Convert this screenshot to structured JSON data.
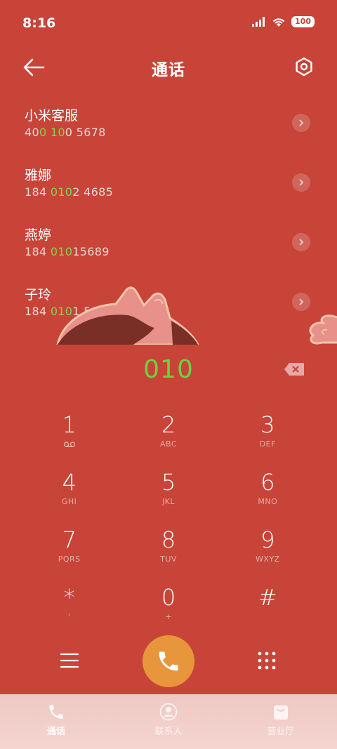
{
  "status": {
    "time": "8:16",
    "battery": "100"
  },
  "header": {
    "title": "通话"
  },
  "results": [
    {
      "name": "小米客服",
      "num_pre": "40",
      "num_match": "0 10",
      "num_post": "0 5678"
    },
    {
      "name": "雅娜",
      "num_pre": "184 ",
      "num_match": "010",
      "num_post": "2 4685"
    },
    {
      "name": "燕婷",
      "num_pre": "184 ",
      "num_match": "010",
      "num_post": "15689"
    },
    {
      "name": "子玲",
      "num_pre": "184 ",
      "num_match": "010",
      "num_post": "1 5678"
    }
  ],
  "dialer": {
    "input": "010"
  },
  "keys": [
    {
      "digit": "1",
      "letters": "voicemail"
    },
    {
      "digit": "2",
      "letters": "ABC"
    },
    {
      "digit": "3",
      "letters": "DEF"
    },
    {
      "digit": "4",
      "letters": "GHI"
    },
    {
      "digit": "5",
      "letters": "JKL"
    },
    {
      "digit": "6",
      "letters": "MNO"
    },
    {
      "digit": "7",
      "letters": "PQRS"
    },
    {
      "digit": "8",
      "letters": "TUV"
    },
    {
      "digit": "9",
      "letters": "WXYZ"
    },
    {
      "digit": "*",
      "letters": "'"
    },
    {
      "digit": "0",
      "letters": "+"
    },
    {
      "digit": "#",
      "letters": ""
    }
  ],
  "tabs": [
    {
      "label": "通话",
      "icon": "phone-icon",
      "active": true
    },
    {
      "label": "联系人",
      "icon": "contacts-icon",
      "active": false
    },
    {
      "label": "营业厅",
      "icon": "store-icon",
      "active": false
    }
  ],
  "colors": {
    "background": "#c84438",
    "match": "#8ad14a",
    "dialed": "#6fd042",
    "call_button": "#e8963c"
  }
}
